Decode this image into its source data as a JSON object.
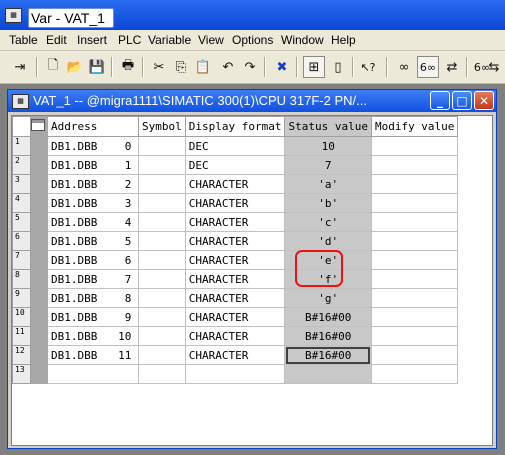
{
  "window": {
    "title": "Var - VAT_1"
  },
  "menu": [
    "Table",
    "Edit",
    "Insert",
    "PLC",
    "Variable",
    "View",
    "Options",
    "Window",
    "Help"
  ],
  "toolbar": [
    {
      "icon": "pin-icon",
      "glyph": "⇥"
    },
    {
      "icon": "new-icon",
      "glyph": "🗋"
    },
    {
      "icon": "open-icon",
      "glyph": "📂"
    },
    {
      "icon": "save-icon",
      "glyph": "💾"
    },
    {
      "icon": "print-icon",
      "glyph": "🖶"
    },
    {
      "icon": "cut-icon",
      "glyph": "✂"
    },
    {
      "icon": "copy-icon",
      "glyph": "⎘"
    },
    {
      "icon": "paste-icon",
      "glyph": "📋"
    },
    {
      "icon": "undo-icon",
      "glyph": "↶"
    },
    {
      "icon": "redo-icon",
      "glyph": "↷"
    },
    {
      "icon": "delete-icon",
      "glyph": "✖"
    },
    {
      "icon": "network-icon",
      "glyph": "⊞"
    },
    {
      "icon": "plc-icon",
      "glyph": "▯"
    },
    {
      "icon": "help-pointer-icon",
      "glyph": "↖?"
    },
    {
      "icon": "monitor-glasses-icon",
      "glyph": "∞"
    },
    {
      "icon": "monitor-variable-icon",
      "glyph": "6∞"
    },
    {
      "icon": "modify-variable-icon",
      "glyph": "⇄"
    },
    {
      "icon": "update-values-icon",
      "glyph": "6∞"
    },
    {
      "icon": "activate-values-icon",
      "glyph": "⇆"
    }
  ],
  "vat_window": {
    "title": "VAT_1 -- @migra1111\\SIMATIC 300(1)\\CPU 317F-2 PN/..."
  },
  "table": {
    "headers": {
      "address": "Address",
      "symbol": "Symbol",
      "format": "Display format",
      "status": "Status value",
      "modify": "Modify value"
    },
    "rows": [
      {
        "num": "1",
        "addr": "DB1.DBB",
        "offset": "0",
        "symbol": "",
        "format": "DEC",
        "status": "10",
        "modify": ""
      },
      {
        "num": "2",
        "addr": "DB1.DBB",
        "offset": "1",
        "symbol": "",
        "format": "DEC",
        "status": "7",
        "modify": ""
      },
      {
        "num": "3",
        "addr": "DB1.DBB",
        "offset": "2",
        "symbol": "",
        "format": "CHARACTER",
        "status": "'a'",
        "modify": ""
      },
      {
        "num": "4",
        "addr": "DB1.DBB",
        "offset": "3",
        "symbol": "",
        "format": "CHARACTER",
        "status": "'b'",
        "modify": ""
      },
      {
        "num": "5",
        "addr": "DB1.DBB",
        "offset": "4",
        "symbol": "",
        "format": "CHARACTER",
        "status": "'c'",
        "modify": ""
      },
      {
        "num": "6",
        "addr": "DB1.DBB",
        "offset": "5",
        "symbol": "",
        "format": "CHARACTER",
        "status": "'d'",
        "modify": ""
      },
      {
        "num": "7",
        "addr": "DB1.DBB",
        "offset": "6",
        "symbol": "",
        "format": "CHARACTER",
        "status": "'e'",
        "modify": ""
      },
      {
        "num": "8",
        "addr": "DB1.DBB",
        "offset": "7",
        "symbol": "",
        "format": "CHARACTER",
        "status": "'f'",
        "modify": ""
      },
      {
        "num": "9",
        "addr": "DB1.DBB",
        "offset": "8",
        "symbol": "",
        "format": "CHARACTER",
        "status": "'g'",
        "modify": ""
      },
      {
        "num": "10",
        "addr": "DB1.DBB",
        "offset": "9",
        "symbol": "",
        "format": "CHARACTER",
        "status": "B#16#00",
        "modify": ""
      },
      {
        "num": "11",
        "addr": "DB1.DBB",
        "offset": "10",
        "symbol": "",
        "format": "CHARACTER",
        "status": "B#16#00",
        "modify": ""
      },
      {
        "num": "12",
        "addr": "DB1.DBB",
        "offset": "11",
        "symbol": "",
        "format": "CHARACTER",
        "status": "B#16#00",
        "modify": ""
      },
      {
        "num": "13",
        "addr": "",
        "offset": "",
        "symbol": "",
        "format": "",
        "status": "",
        "modify": ""
      }
    ],
    "selected_row": 12
  },
  "colors": {
    "title_blue": "#0b48d6",
    "highlight_red": "#e11111",
    "status_column": "#c8c8c8"
  }
}
